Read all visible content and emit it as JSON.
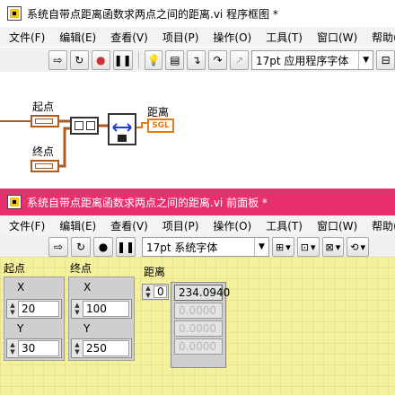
{
  "bd_window": {
    "title": "系统自带点距离函数求两点之间的距离.vi 程序框图 *",
    "menu": [
      "文件(F)",
      "编辑(E)",
      "查看(V)",
      "项目(P)",
      "操作(O)",
      "工具(T)",
      "窗口(W)",
      "帮助(H)"
    ],
    "font_selector": "17pt 应用程序字体",
    "labels": {
      "start": "起点",
      "end": "终点",
      "distance": "距离",
      "indicator_type": "SGL"
    }
  },
  "fp_window": {
    "title": "系统自带点距离函数求两点之间的距离.vi 前面板 *",
    "menu": [
      "文件(F)",
      "编辑(E)",
      "查看(V)",
      "项目(P)",
      "操作(O)",
      "工具(T)",
      "窗口(W)",
      "帮助(H)"
    ],
    "font_selector": "17pt 系统字体",
    "start_point": {
      "label": "起点",
      "x_label": "X",
      "x_value": "20",
      "y_label": "Y",
      "y_value": "30"
    },
    "end_point": {
      "label": "终点",
      "x_label": "X",
      "x_value": "100",
      "y_label": "Y",
      "y_value": "250"
    },
    "distance": {
      "label": "距离",
      "index": "0",
      "values": [
        "234.0940",
        "0.0000",
        "0.0000",
        "0.0000"
      ]
    }
  },
  "colors": {
    "bd_title_bg": "#ffffff",
    "fp_title_bg": "#e8306e",
    "panel_bg": "#f4f19c",
    "wire_cluster": "#b05a1c",
    "wire_array": "#e07b1a"
  }
}
